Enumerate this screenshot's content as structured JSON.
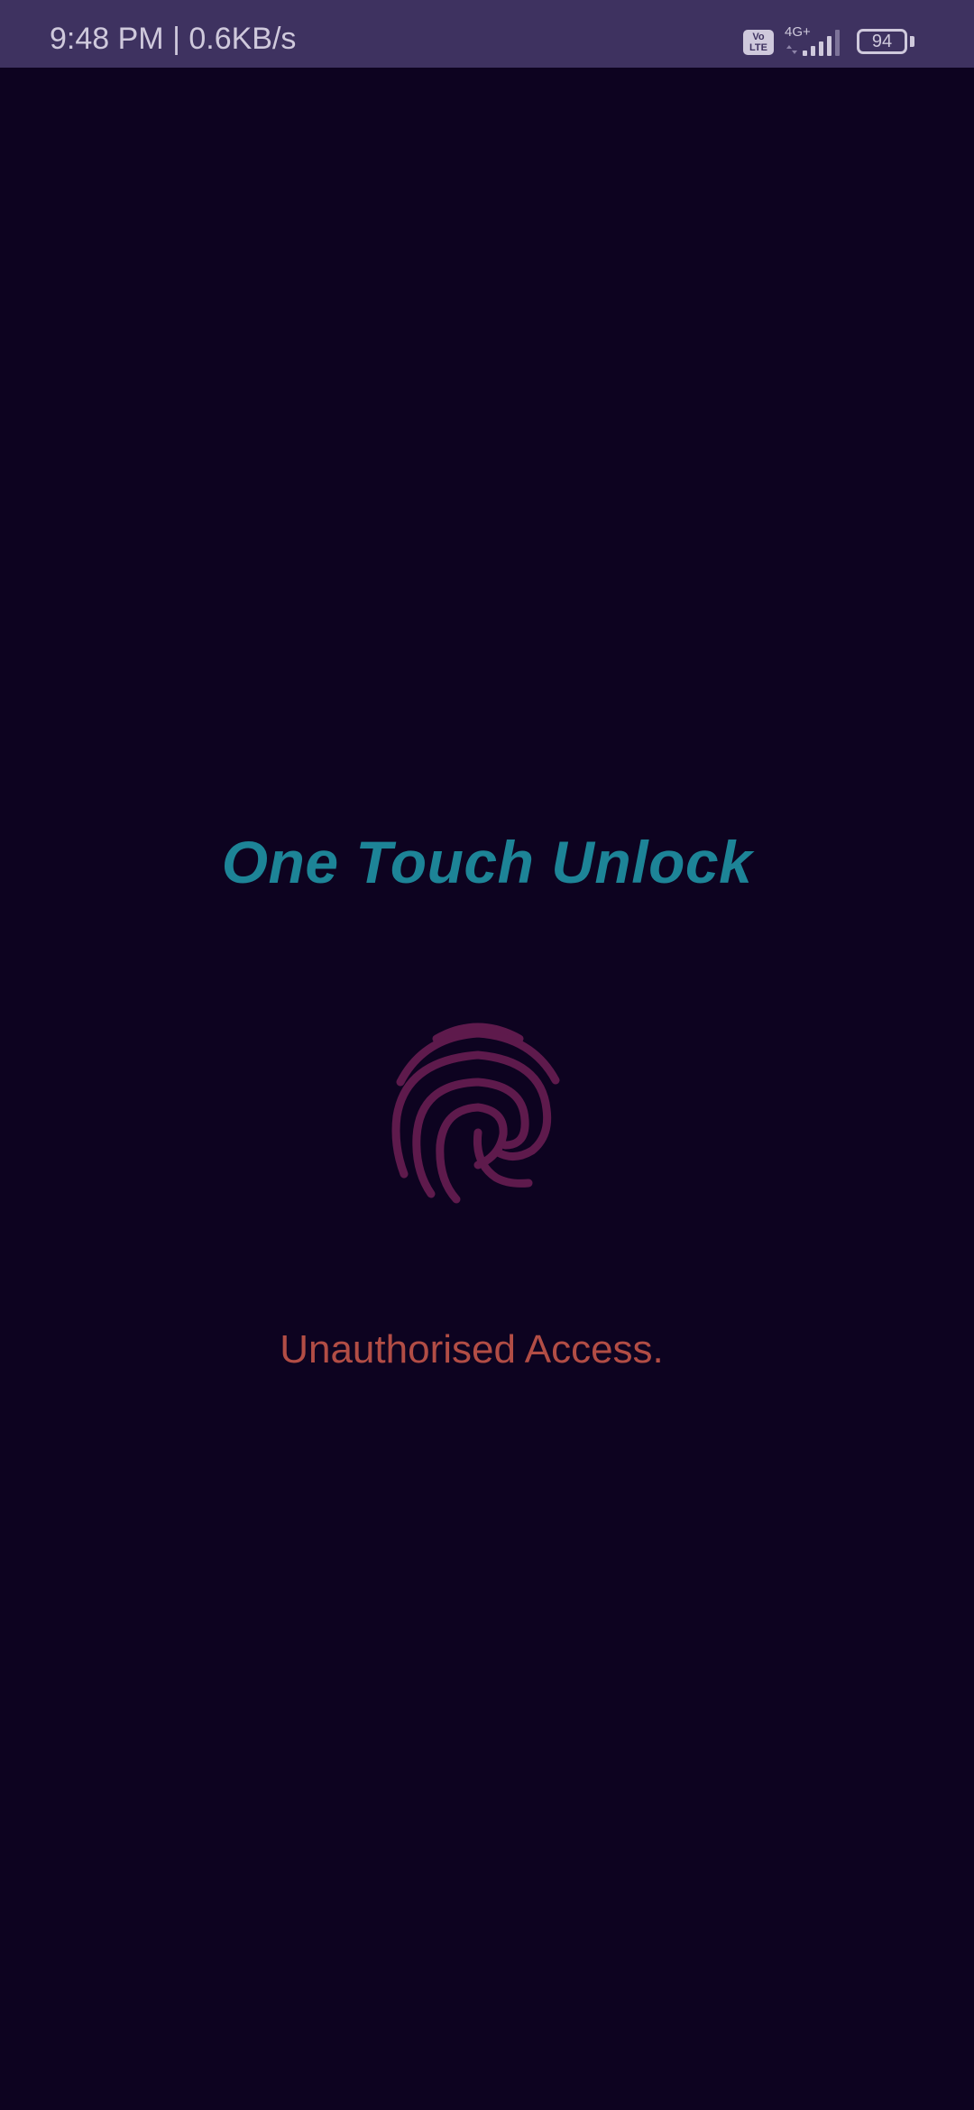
{
  "status_bar": {
    "time": "9:48 PM | 0.6KB/s",
    "volte_label_top": "Vo",
    "volte_label_bottom": "LTE",
    "network_type": "4G+",
    "battery_level": "94",
    "signal_icon": "signal-bars-icon",
    "battery_icon": "battery-icon"
  },
  "main": {
    "title": "One Touch Unlock",
    "fingerprint_icon": "fingerprint-icon",
    "message": "Unauthorised Access."
  },
  "colors": {
    "background": "#0d0320",
    "status_bar": "#3e3260",
    "title": "#1d8497",
    "fingerprint": "#5e1a4c",
    "message": "#b24d45"
  }
}
